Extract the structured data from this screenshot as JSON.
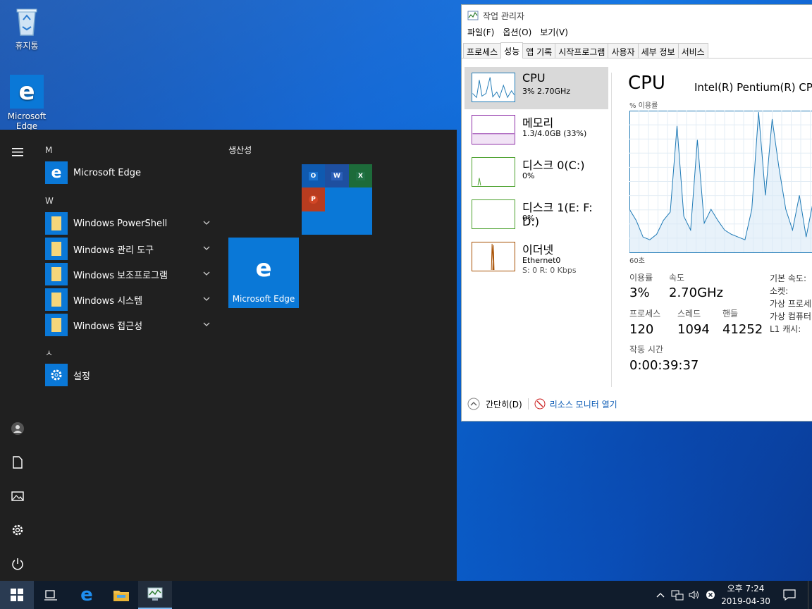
{
  "desktop": {
    "icons": [
      {
        "label": "휴지통",
        "icon": "recycle-bin-icon"
      },
      {
        "label": "Microsoft Edge",
        "icon": "edge-icon"
      }
    ]
  },
  "start_menu": {
    "letters": [
      "M",
      "W",
      "ㅅ"
    ],
    "apps": [
      {
        "label": "Microsoft Edge",
        "icon": "edge-icon",
        "expandable": false
      },
      {
        "label": "Windows PowerShell",
        "icon": "folder-icon",
        "expandable": true
      },
      {
        "label": "Windows 관리 도구",
        "icon": "folder-icon",
        "expandable": true
      },
      {
        "label": "Windows 보조프로그램",
        "icon": "folder-icon",
        "expandable": true
      },
      {
        "label": "Windows 시스템",
        "icon": "folder-icon",
        "expandable": true
      },
      {
        "label": "Windows 접근성",
        "icon": "folder-icon",
        "expandable": true
      },
      {
        "label": "설정",
        "icon": "gear-icon",
        "expandable": false
      }
    ],
    "group_title": "생산성",
    "tile_edge_label": "Microsoft Edge",
    "mini_tiles": [
      {
        "letter": "O",
        "app": "outlook",
        "color": "#0f5ab0"
      },
      {
        "letter": "W",
        "app": "word",
        "color": "#1e4fa0"
      },
      {
        "letter": "X",
        "app": "excel",
        "color": "#1d6b3a"
      },
      {
        "letter": "P",
        "app": "powerpoint",
        "color": "#b83c1f"
      }
    ],
    "accent": "#0a78d7"
  },
  "task_manager": {
    "title": "작업 관리자",
    "menu": [
      "파일(F)",
      "옵션(O)",
      "보기(V)"
    ],
    "tabs": [
      "프로세스",
      "성능",
      "앱 기록",
      "시작프로그램",
      "사용자",
      "세부 정보",
      "서비스"
    ],
    "active_tab": "성능",
    "side": [
      {
        "name": "CPU",
        "line1": "3% 2.70GHz",
        "line2": "",
        "color": "#1f7ab6"
      },
      {
        "name": "메모리",
        "line1": "1.3/4.0GB (33%)",
        "line2": "",
        "color": "#8e2fa7"
      },
      {
        "name": "디스크 0(C:)",
        "line1": "0%",
        "line2": "",
        "color": "#4aa02c"
      },
      {
        "name": "디스크 1(E: F: D:)",
        "line1": "0%",
        "line2": "",
        "color": "#4aa02c"
      },
      {
        "name": "이더넷",
        "line1": "Ethernet0",
        "line2": "S: 0  R: 0 Kbps",
        "color": "#a74f01"
      }
    ],
    "heading": "CPU",
    "cpu_model": "Intel(R) Pentium(R) CPU",
    "graph_label": "% 이용률",
    "graph_time": "60초",
    "cpu_series": [
      30,
      22,
      10,
      8,
      12,
      22,
      28,
      90,
      25,
      15,
      80,
      20,
      30,
      22,
      15,
      12,
      10,
      8,
      30,
      100,
      40,
      95,
      60,
      30,
      15,
      40,
      10,
      35,
      20
    ],
    "stats": {
      "util_label": "이용률",
      "util": "3%",
      "speed_label": "속도",
      "speed": "2.70GHz",
      "proc_label": "프로세스",
      "proc": "120",
      "thread_label": "스레드",
      "thread": "1094",
      "handle_label": "핸들",
      "handle": "41252",
      "uptime_label": "작동 시간",
      "uptime": "0:00:39:37"
    },
    "right_labels": [
      "기본 속도:",
      "소켓:",
      "가상 프로세",
      "가상 컴퓨터",
      "L1 캐시:"
    ],
    "footer_less": "간단히(D)",
    "footer_monitor": "리소스 모니터 열기"
  },
  "taskbar": {
    "time": "오후 7:24",
    "date": "2019-04-30"
  }
}
